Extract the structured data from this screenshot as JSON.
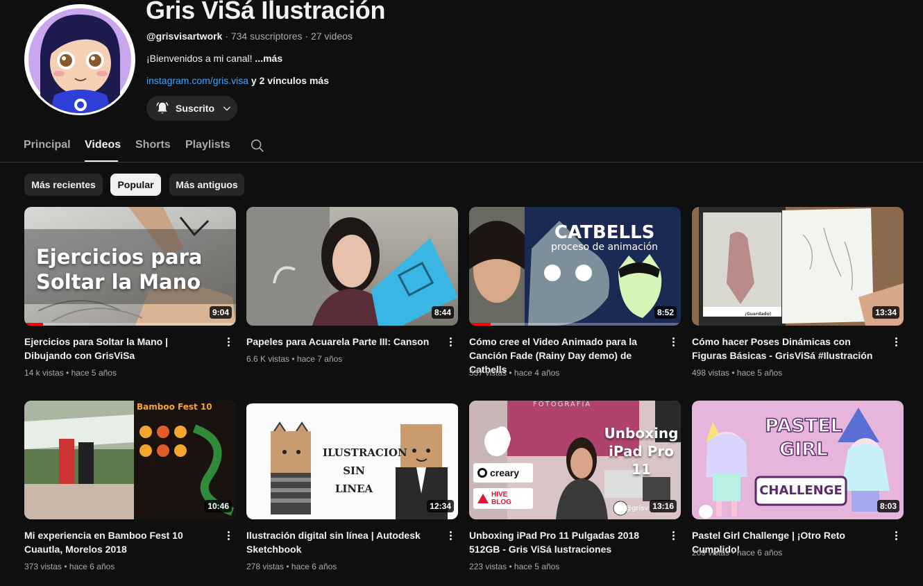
{
  "channel": {
    "title": "Gris ViSá Ilustración",
    "handle": "@grisvisartwork",
    "subscribers": " · 734 suscriptores · 27 videos",
    "description": "¡Bienvenidos a mi canal! ",
    "more": "...más",
    "link": "instagram.com/gris.visa",
    "extra_links": " y 2 vínculos más",
    "subscribe_label": "Suscrito"
  },
  "tabs": [
    {
      "label": "Principal"
    },
    {
      "label": "Videos"
    },
    {
      "label": "Shorts"
    },
    {
      "label": "Playlists"
    }
  ],
  "chips": [
    {
      "label": "Más recientes"
    },
    {
      "label": "Popular"
    },
    {
      "label": "Más antiguos"
    }
  ],
  "videos": [
    {
      "title": "Ejercicios para Soltar la Mano | Dibujando con GrisViSa",
      "views": "14 k vistas",
      "age": "hace 5 años",
      "duration": "9:04",
      "thumb_text": "Ejercicios para Soltar la Mano",
      "progress": 0.09
    },
    {
      "title": "Papeles para Acuarela Parte III: Canson",
      "views": "6.6 K vistas",
      "age": "hace 7 años",
      "duration": "8:44"
    },
    {
      "title": "Cómo cree el Video Animado para la Canción Fade (Rainy Day demo) de Catbells",
      "views": "537 vistas",
      "age": "hace 4 años",
      "duration": "8:52",
      "thumb_text": "CATBELLS",
      "thumb_sub": "proceso de animación",
      "progress": 0.1
    },
    {
      "title": "Cómo hacer Poses Dinámicas con Figuras Básicas - GrisViSá #Ilustración",
      "views": "498 vistas",
      "age": "hace 5 años",
      "duration": "13:34",
      "thumb_small": "¡Guardado!"
    },
    {
      "title": "Mi experiencia en Bamboo Fest 10 Cuautla, Morelos 2018",
      "views": "373 vistas",
      "age": "hace 6 años",
      "duration": "10:46",
      "thumb_text": "Bamboo Fest 10"
    },
    {
      "title": "Ilustración digital sin línea | Autodesk Sketchbook",
      "views": "278 vistas",
      "age": "hace 6 años",
      "duration": "12:34",
      "thumb_text": "ILUSTRACION SIN LINEA"
    },
    {
      "title": "Unboxing iPad Pro 11 Pulgadas 2018 512GB - Gris ViSá lustraciones",
      "views": "223 vistas",
      "age": "hace 5 años",
      "duration": "13:16",
      "thumb_text": "Unboxing iPad Pro 11",
      "thumb_top": "FOTOGRAFIA",
      "badge1": "creary",
      "badge2": "HIVE BLOG",
      "watermark": "@grisv"
    },
    {
      "title": "Pastel Girl Challenge | ¡Otro Reto Cumplido!",
      "views": "209 vistas",
      "age": "hace 6 años",
      "duration": "8:03",
      "thumb_text": "PASTEL GIRL",
      "thumb_sub": "CHALLENGE"
    }
  ],
  "colors": {
    "background": "#0f0f0f",
    "chip": "#272727",
    "link": "#3ea6ff",
    "progress": "#ff0000"
  }
}
